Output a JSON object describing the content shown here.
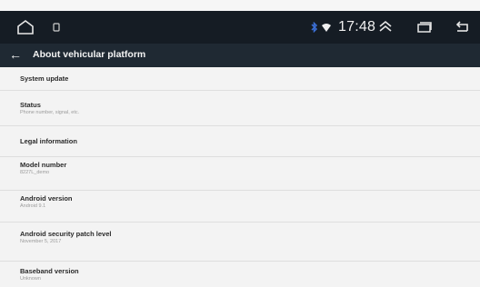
{
  "status_bar": {
    "time": "17:48",
    "icons": [
      "home-outline-icon",
      "notification-icon",
      "bluetooth-icon",
      "wifi-icon",
      "chevron-up-icon",
      "recent-apps-icon",
      "back-icon"
    ],
    "colors": {
      "background": "#151c24",
      "accent_bluetooth": "#3b6fd6"
    }
  },
  "app_bar": {
    "back_label": "←",
    "title": "About vehicular platform",
    "background": "#1f2933"
  },
  "items": [
    {
      "title": "System update",
      "subtitle": ""
    },
    {
      "title": "Status",
      "subtitle": "Phone number, signal, etc."
    },
    {
      "title": "Legal information",
      "subtitle": ""
    },
    {
      "title": "Model number",
      "subtitle": "8227L_demo"
    },
    {
      "title": "Android version",
      "subtitle": "Android 9.1"
    },
    {
      "title": "Android security patch level",
      "subtitle": "November 5, 2017"
    },
    {
      "title": "Baseband version",
      "subtitle": "Unknown"
    }
  ]
}
